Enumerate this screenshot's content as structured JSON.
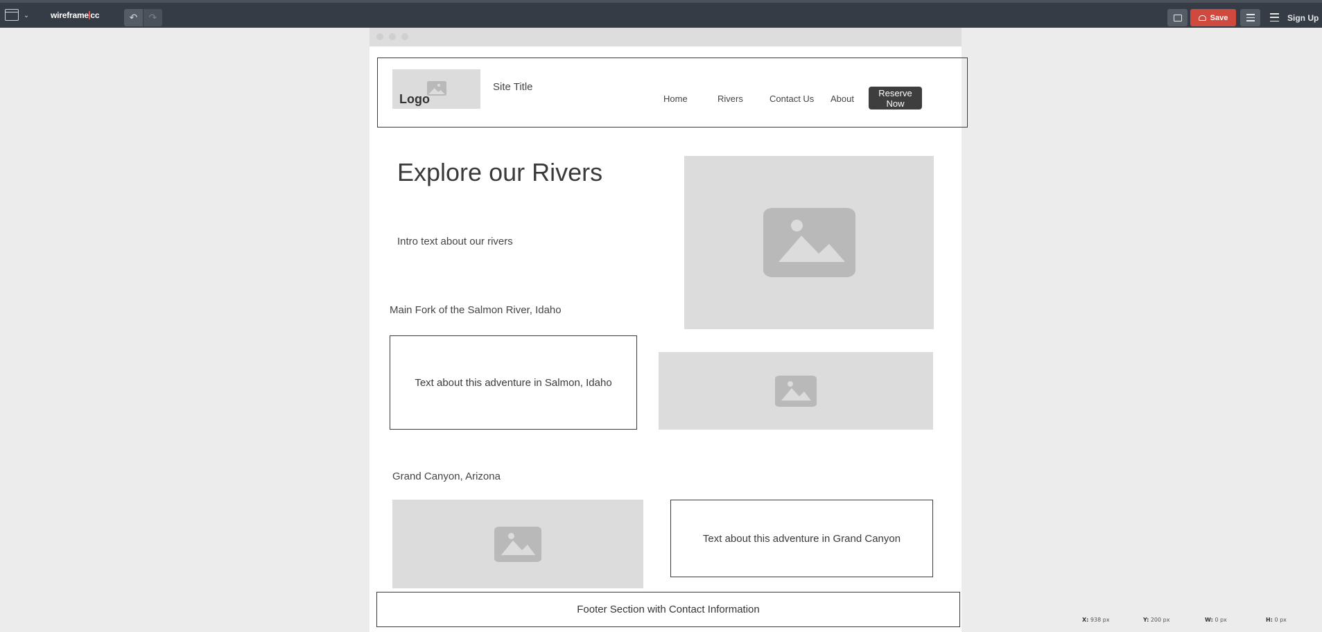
{
  "toolbar": {
    "brand_left": "wireframe",
    "brand_right": "cc",
    "undo_icon": "↶",
    "redo_icon": "↷",
    "chevron_icon": "⌄",
    "save_label": "Save",
    "signup_label": "Sign Up"
  },
  "wireframe": {
    "header": {
      "logo_label": "Logo",
      "site_title": "Site Title",
      "nav": [
        "Home",
        "Rivers",
        "Contact Us",
        "About"
      ],
      "cta_label": "Reserve Now"
    },
    "hero": {
      "title": "Explore our Rivers",
      "intro": "Intro text about our rivers"
    },
    "sections": [
      {
        "title": "Main Fork of the Salmon River, Idaho",
        "text": "Text about this adventure in Salmon, Idaho"
      },
      {
        "title": "Grand Canyon, Arizona",
        "text": "Text about this adventure in Grand Canyon"
      }
    ],
    "footer": "Footer Section with Contact Information"
  },
  "status_bar": {
    "x_label": "X:",
    "x_value": "938 px",
    "y_label": "Y:",
    "y_value": "200 px",
    "w_label": "W:",
    "w_value": "0 px",
    "h_label": "H:",
    "h_value": "0 px"
  },
  "colors": {
    "toolbar_bg": "#353c46",
    "save_red": "#d0493f",
    "placeholder_gray": "#dcdcdc",
    "canvas_bg": "#ececec"
  }
}
